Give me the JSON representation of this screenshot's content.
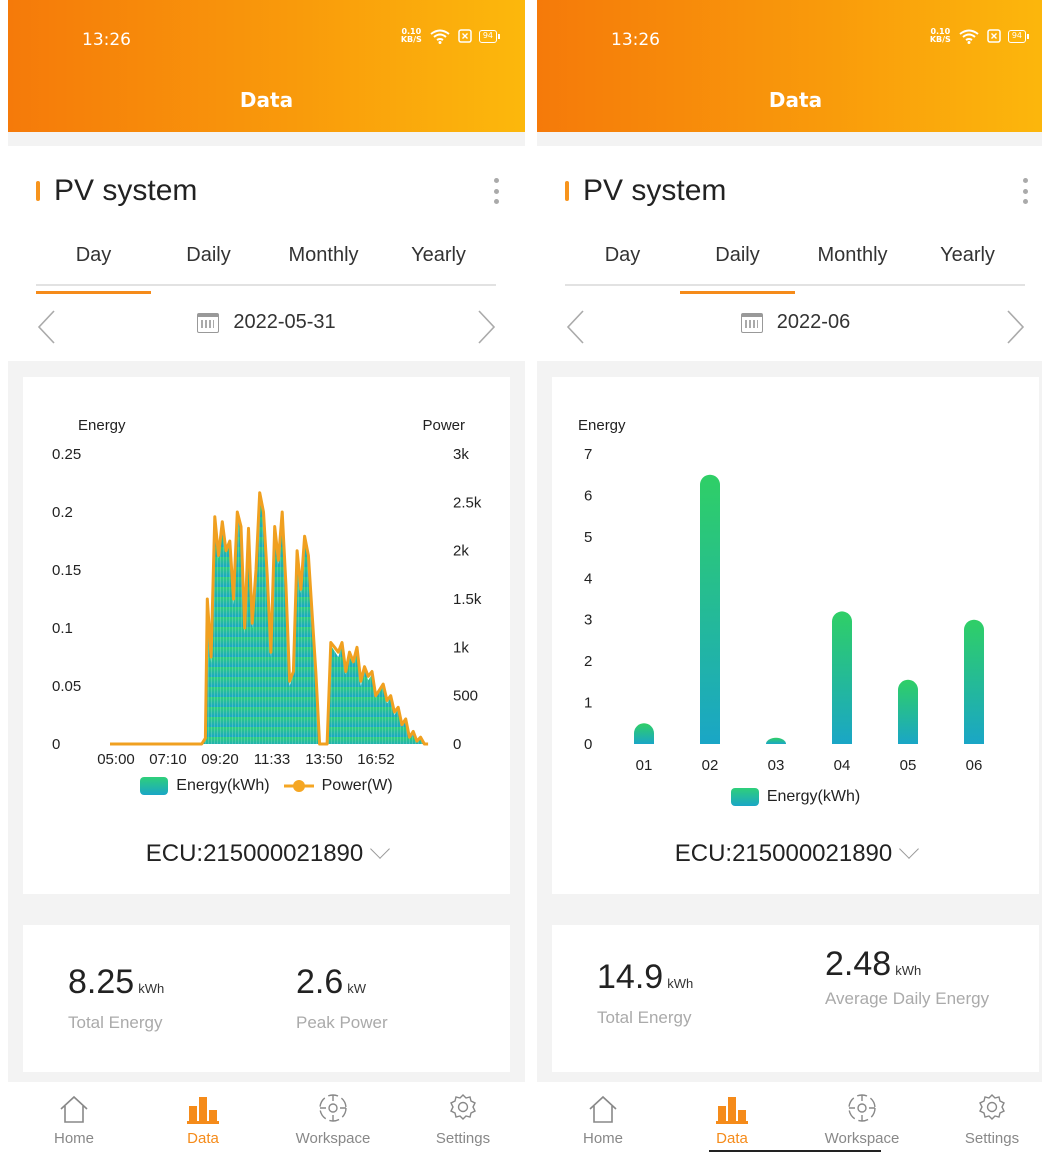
{
  "screens": [
    {
      "status": {
        "time": "13:26",
        "net_speed_top": "0.10",
        "net_speed_bottom": "KB/S",
        "battery": "94"
      },
      "header_title": "Data",
      "system_title": "PV system",
      "tabs": [
        "Day",
        "Daily",
        "Monthly",
        "Yearly"
      ],
      "active_tab": 0,
      "date": "2022-05-31",
      "ecu": "ECU:215000021890",
      "stats": [
        {
          "value": "8.25",
          "unit": "kWh",
          "label": "Total Energy"
        },
        {
          "value": "2.6",
          "unit": "kW",
          "label": "Peak Power"
        }
      ],
      "nav": [
        {
          "label": "Home",
          "icon": "home-icon"
        },
        {
          "label": "Data",
          "icon": "bar-chart-icon"
        },
        {
          "label": "Workspace",
          "icon": "workspace-icon"
        },
        {
          "label": "Settings",
          "icon": "gear-icon"
        }
      ],
      "active_nav": 1
    },
    {
      "status": {
        "time": "13:26",
        "net_speed_top": "0.10",
        "net_speed_bottom": "KB/S",
        "battery": "94"
      },
      "header_title": "Data",
      "system_title": "PV system",
      "tabs": [
        "Day",
        "Daily",
        "Monthly",
        "Yearly"
      ],
      "active_tab": 1,
      "date": "2022-06",
      "ecu": "ECU:215000021890",
      "stats": [
        {
          "value": "14.9",
          "unit": "kWh",
          "label": "Total Energy"
        },
        {
          "value": "2.48",
          "unit": "kWh",
          "label": "Average Daily Energy"
        }
      ],
      "nav": [
        {
          "label": "Home",
          "icon": "home-icon"
        },
        {
          "label": "Data",
          "icon": "bar-chart-icon"
        },
        {
          "label": "Workspace",
          "icon": "workspace-icon"
        },
        {
          "label": "Settings",
          "icon": "gear-icon"
        }
      ],
      "active_nav": 1
    }
  ],
  "colors": {
    "accent": "#f58b1a",
    "energy_top": "#2ecc71",
    "energy_bottom": "#1fa5c9",
    "power": "#f5a623"
  },
  "chart_data": [
    {
      "type": "area",
      "left_axis_label": "Energy",
      "right_axis_label": "Power",
      "y_left_ticks": [
        "0",
        "0.05",
        "0.1",
        "0.15",
        "0.2",
        "0.25"
      ],
      "y_right_ticks": [
        "0",
        "500",
        "1k",
        "1.5k",
        "2k",
        "2.5k",
        "3k"
      ],
      "ylim_left": [
        0,
        0.25
      ],
      "ylim_right": [
        0,
        3000
      ],
      "x_ticks": [
        "05:00",
        "07:10",
        "09:20",
        "11:33",
        "13:50",
        "16:52"
      ],
      "x_range_hours": [
        5.0,
        19.25
      ],
      "legend": [
        "Energy(kWh)",
        "Power(W)"
      ],
      "series": [
        {
          "name": "Energy(kWh)",
          "x": [
            "05:00",
            "09:05",
            "09:15",
            "09:20",
            "09:30",
            "09:40",
            "09:50",
            "10:00",
            "10:10",
            "10:20",
            "10:30",
            "10:40",
            "10:50",
            "11:00",
            "11:10",
            "11:20",
            "11:30",
            "11:40",
            "11:50",
            "12:00",
            "12:10",
            "12:20",
            "12:30",
            "12:40",
            "12:50",
            "13:00",
            "13:10",
            "13:20",
            "13:30",
            "13:40",
            "13:50",
            "14:00",
            "14:10",
            "14:20",
            "14:30",
            "14:40",
            "14:50",
            "15:00",
            "15:10",
            "15:20",
            "15:30",
            "15:40",
            "15:50",
            "16:00",
            "16:10",
            "16:20",
            "16:30",
            "16:40",
            "16:50",
            "17:00",
            "17:10",
            "17:20",
            "17:30",
            "17:40",
            "17:50",
            "18:00",
            "18:10",
            "18:20",
            "18:30",
            "18:40",
            "18:50",
            "19:00",
            "19:10"
          ],
          "values": [
            0,
            0,
            0.005,
            0.12,
            0.07,
            0.195,
            0.16,
            0.19,
            0.165,
            0.175,
            0.12,
            0.2,
            0.185,
            0.095,
            0.185,
            0.1,
            0.15,
            0.21,
            0.2,
            0.145,
            0.075,
            0.185,
            0.155,
            0.2,
            0.135,
            0.05,
            0.06,
            0.165,
            0.13,
            0.18,
            0.16,
            0.11,
            0.06,
            0,
            0,
            0,
            0.085,
            0.08,
            0.075,
            0.085,
            0.06,
            0.075,
            0.07,
            0.08,
            0.05,
            0.065,
            0.055,
            0.06,
            0.04,
            0.045,
            0.05,
            0.035,
            0.04,
            0.025,
            0.03,
            0.015,
            0.02,
            0.005,
            0.01,
            0.002,
            0.005,
            0,
            0
          ]
        },
        {
          "name": "Power(W)",
          "x": [
            "05:00",
            "09:05",
            "09:15",
            "09:20",
            "09:30",
            "09:40",
            "09:50",
            "10:00",
            "10:10",
            "10:20",
            "10:30",
            "10:40",
            "10:50",
            "11:00",
            "11:10",
            "11:20",
            "11:30",
            "11:40",
            "11:50",
            "12:00",
            "12:10",
            "12:20",
            "12:30",
            "12:40",
            "12:50",
            "13:00",
            "13:10",
            "13:20",
            "13:30",
            "13:40",
            "13:50",
            "14:00",
            "14:10",
            "14:20",
            "14:30",
            "14:40",
            "14:50",
            "15:00",
            "15:10",
            "15:20",
            "15:30",
            "15:40",
            "15:50",
            "16:00",
            "16:10",
            "16:20",
            "16:30",
            "16:40",
            "16:50",
            "17:00",
            "17:10",
            "17:20",
            "17:30",
            "17:40",
            "17:50",
            "18:00",
            "18:10",
            "18:20",
            "18:30",
            "18:40",
            "18:50",
            "19:00",
            "19:10"
          ],
          "values": [
            0,
            0,
            60,
            1500,
            900,
            2350,
            1950,
            2300,
            2000,
            2100,
            1500,
            2400,
            2250,
            1200,
            2230,
            1250,
            1800,
            2600,
            2400,
            1750,
            950,
            2250,
            1900,
            2400,
            1650,
            650,
            750,
            2000,
            1600,
            2150,
            1950,
            1350,
            750,
            0,
            0,
            0,
            1050,
            1000,
            950,
            1050,
            750,
            950,
            850,
            1000,
            650,
            800,
            700,
            750,
            500,
            560,
            620,
            450,
            500,
            330,
            380,
            200,
            260,
            70,
            130,
            30,
            70,
            0,
            0
          ]
        }
      ]
    },
    {
      "type": "bar",
      "left_axis_label": "Energy",
      "y_ticks": [
        "0",
        "1",
        "2",
        "3",
        "4",
        "5",
        "6",
        "7"
      ],
      "ylim": [
        0,
        7
      ],
      "categories": [
        "01",
        "02",
        "03",
        "04",
        "05",
        "06"
      ],
      "legend": [
        "Energy(kWh)"
      ],
      "series": [
        {
          "name": "Energy(kWh)",
          "values": [
            0.5,
            6.5,
            0.15,
            3.2,
            1.55,
            3.0
          ]
        }
      ]
    }
  ]
}
